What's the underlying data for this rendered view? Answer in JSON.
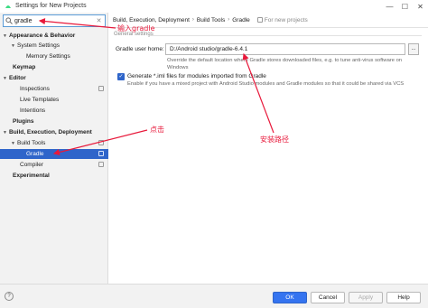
{
  "window": {
    "title": "Settings for New Projects",
    "minimize_glyph": "—",
    "maximize_glyph": "☐",
    "close_glyph": "✕"
  },
  "search": {
    "value": "gradle",
    "icon": "search-icon",
    "clear_glyph": "✕"
  },
  "sidebar": {
    "items": [
      {
        "label": "Appearance & Behavior",
        "arrow": "▼"
      },
      {
        "label": "System Settings",
        "arrow": "▼"
      },
      {
        "label": "Memory Settings",
        "arrow": ""
      },
      {
        "label": "Keymap",
        "arrow": ""
      },
      {
        "label": "Editor",
        "arrow": "▼"
      },
      {
        "label": "Inspections",
        "arrow": ""
      },
      {
        "label": "Live Templates",
        "arrow": ""
      },
      {
        "label": "Intentions",
        "arrow": ""
      },
      {
        "label": "Plugins",
        "arrow": ""
      },
      {
        "label": "Build, Execution, Deployment",
        "arrow": "▼"
      },
      {
        "label": "Build Tools",
        "arrow": "▼"
      },
      {
        "label": "Gradle",
        "arrow": ""
      },
      {
        "label": "Compiler",
        "arrow": ""
      },
      {
        "label": "Experimental",
        "arrow": ""
      }
    ]
  },
  "breadcrumb": {
    "items": [
      "Build, Execution, Deployment",
      "Build Tools",
      "Gradle"
    ],
    "separator": "›",
    "scope_label": "For new projects"
  },
  "general": {
    "section_title": "General settings",
    "user_home_label": "Gradle user home:",
    "user_home_value": "D:/Android studio/gradle-6.4.1",
    "browse_label": "...",
    "user_home_help": "Override the default location where Gradle stores downloaded files, e.g. to tune anti-virus software on Windows",
    "iml_label": "Generate *.iml files for modules imported from Gradle",
    "iml_checked_glyph": "✓",
    "iml_help": "Enable if you have a mixed project with Android Studio modules and Gradle modules so that it could be shared via VCS"
  },
  "footer": {
    "help_glyph": "?",
    "ok_label": "OK",
    "cancel_label": "Cancel",
    "apply_label": "Apply",
    "help_label": "Help"
  },
  "annotations": {
    "search_note": "输入gradle",
    "click_note": "点击",
    "path_note": "安装路径",
    "color": "#e8193b"
  },
  "colors": {
    "accent": "#2f65ca",
    "primary_button": "#3574f0"
  }
}
